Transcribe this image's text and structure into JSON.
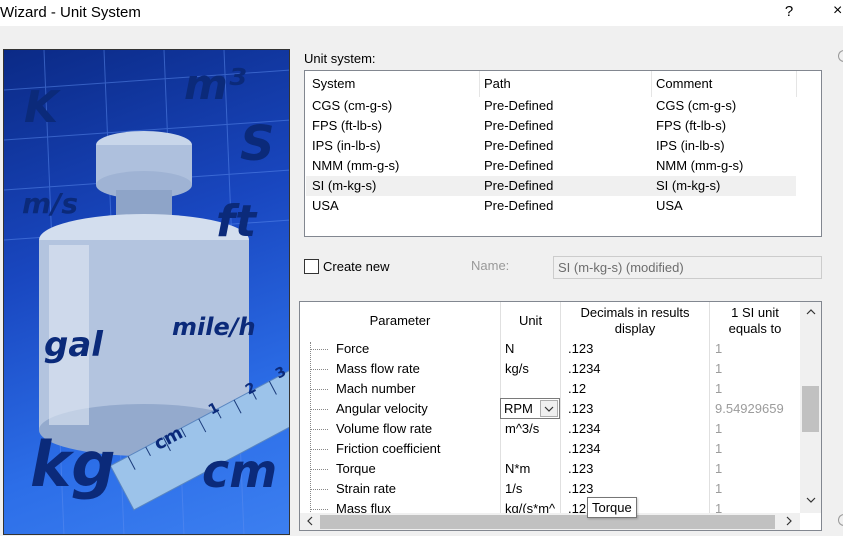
{
  "window": {
    "title": "Wizard - Unit System",
    "help_glyph": "?",
    "close_glyph": "×"
  },
  "side_image": {
    "words": [
      "K",
      "m³",
      "S",
      "m/s",
      "ft",
      "gal",
      "mile/h",
      "kg",
      "cm"
    ],
    "ruler_labels": [
      "cm",
      "1",
      "2",
      "3"
    ]
  },
  "unit_system": {
    "label": "Unit system:",
    "columns": [
      "System",
      "Path",
      "Comment"
    ],
    "rows": [
      {
        "system": "CGS (cm-g-s)",
        "path": "Pre-Defined",
        "comment": "CGS (cm-g-s)"
      },
      {
        "system": "FPS (ft-lb-s)",
        "path": "Pre-Defined",
        "comment": "FPS (ft-lb-s)"
      },
      {
        "system": "IPS (in-lb-s)",
        "path": "Pre-Defined",
        "comment": "IPS (in-lb-s)"
      },
      {
        "system": "NMM (mm-g-s)",
        "path": "Pre-Defined",
        "comment": "NMM (mm-g-s)"
      },
      {
        "system": "SI (m-kg-s)",
        "path": "Pre-Defined",
        "comment": "SI (m-kg-s)"
      },
      {
        "system": "USA",
        "path": "Pre-Defined",
        "comment": "USA"
      }
    ],
    "selected_index": 4
  },
  "create_new": {
    "label": "Create new",
    "checked": false,
    "name_label": "Name:",
    "name_value": "SI (m-kg-s) (modified)"
  },
  "parameters": {
    "columns": {
      "parameter": "Parameter",
      "unit": "Unit",
      "decimals": "Decimals in results display",
      "equals": "1 SI unit equals to"
    },
    "rows": [
      {
        "name": "Force",
        "unit": "N",
        "decimals": ".123",
        "equals": "1"
      },
      {
        "name": "Mass flow rate",
        "unit": "kg/s",
        "decimals": ".1234",
        "equals": "1"
      },
      {
        "name": "Mach number",
        "unit": "",
        "decimals": ".12",
        "equals": "1"
      },
      {
        "name": "Angular velocity",
        "unit": "RPM",
        "decimals": ".123",
        "equals": "9.54929659"
      },
      {
        "name": "Volume flow rate",
        "unit": "m^3/s",
        "decimals": ".1234",
        "equals": "1"
      },
      {
        "name": "Friction coefficient",
        "unit": "",
        "decimals": ".1234",
        "equals": "1"
      },
      {
        "name": "Torque",
        "unit": "N*m",
        "decimals": ".123",
        "equals": "1"
      },
      {
        "name": "Strain rate",
        "unit": "1/s",
        "decimals": ".123",
        "equals": "1"
      },
      {
        "name": "Mass flux",
        "unit": "kg/(s*m^",
        "decimals": ".12",
        "equals": "1"
      }
    ],
    "editing_row_index": 3
  },
  "tooltip": "Torque"
}
